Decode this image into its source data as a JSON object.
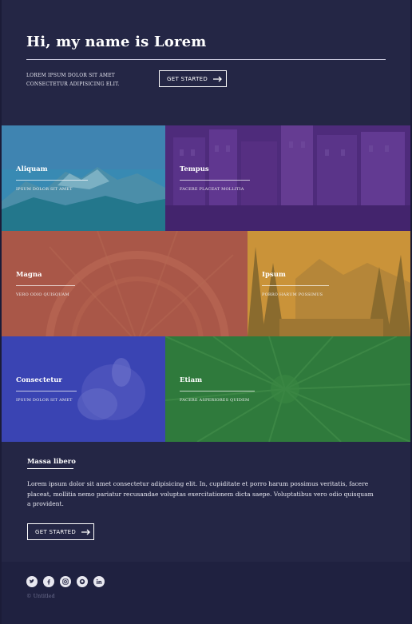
{
  "header": {
    "title": "Hi, my name is Lorem",
    "intro": "LOREM IPSUM DOLOR SIT AMET CONSECTETUR ADIPISICING ELIT.",
    "cta_label": "GET STARTED"
  },
  "tiles": [
    {
      "title": "Aliquam",
      "subtitle": "IPSUM DOLOR SIT AMET",
      "overlay": "#2c8fb0"
    },
    {
      "title": "Tempus",
      "subtitle": "FACERE PLACEAT MOLLITIA",
      "overlay": "#5b2d8c"
    },
    {
      "title": "Magna",
      "subtitle": "VERO ODIO QUISQUAM",
      "overlay": "#b35a45"
    },
    {
      "title": "Ipsum",
      "subtitle": "PORRO HARUM POSSIMUS",
      "overlay": "#d19637"
    },
    {
      "title": "Consectetur",
      "subtitle": "IPSUM DOLOR SIT AMET",
      "overlay": "#3a43b8"
    },
    {
      "title": "Etiam",
      "subtitle": "FACERE ASPERIORES QUIDEM",
      "overlay": "#2f7a3c"
    }
  ],
  "massa": {
    "title": "Massa libero",
    "body": "Lorem ipsum dolor sit amet consectetur adipisicing elit. In, cupiditate et porro harum possimus veritatis, facere placeat, mollitia nemo pariatur recusandae voluptas exercitationem dicta saepe. Voluptatibus vero odio quisquam a provident.",
    "cta_label": "GET STARTED"
  },
  "footer": {
    "social": [
      "twitter-icon",
      "facebook-icon",
      "instagram-icon",
      "github-icon",
      "linkedin-icon"
    ],
    "copyright": "© Untitled"
  }
}
